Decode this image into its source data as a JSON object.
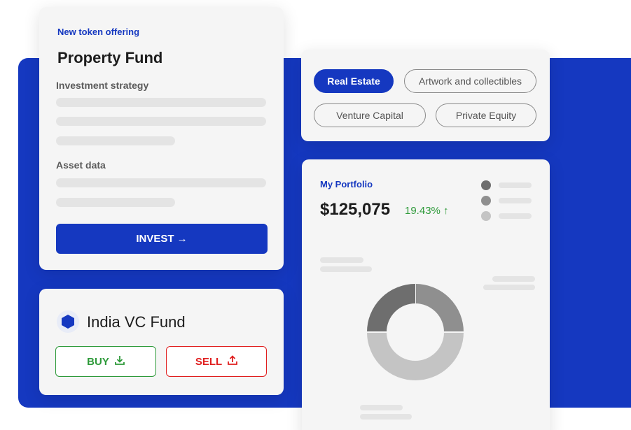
{
  "property_card": {
    "eyebrow": "New token offering",
    "title": "Property Fund",
    "investment_strategy_label": "Investment strategy",
    "asset_data_label": "Asset data",
    "invest_label": "INVEST →"
  },
  "india_card": {
    "fund_name": "India VC Fund",
    "buy_label": "BUY",
    "sell_label": "SELL"
  },
  "categories": {
    "items": [
      "Real Estate",
      "Artwork and collectibles",
      "Venture Capital",
      "Private Equity"
    ],
    "active": "Real Estate"
  },
  "portfolio": {
    "label": "My Portfolio",
    "value": "$125,075",
    "change": "19.43% ↑",
    "legend_colors": [
      "#6e6e6e",
      "#8f8f8f",
      "#c4c4c4"
    ],
    "donut_shares": [
      0.25,
      0.5,
      0.25
    ],
    "donut_colors": [
      "#8f8f8f",
      "#c4c4c4",
      "#6e6e6e"
    ]
  },
  "colors": {
    "brand": "#1538c0",
    "buy": "#2e9a3a",
    "sell": "#e01e1e",
    "positive": "#2e9a3a"
  },
  "icons": [
    "fund-hexagon-icon",
    "buy-download-icon",
    "sell-upload-icon",
    "arrow-up-icon"
  ]
}
